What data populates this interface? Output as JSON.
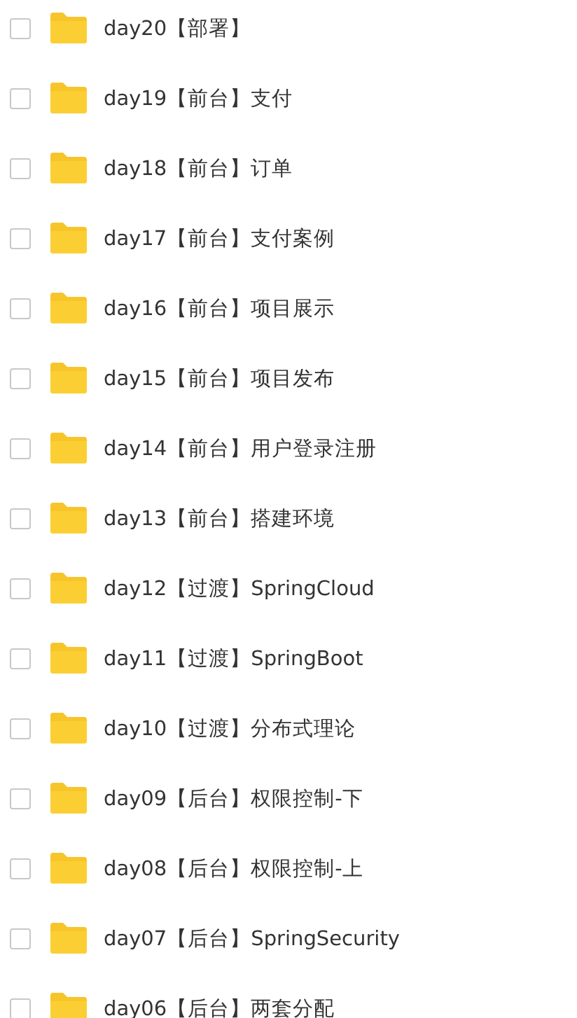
{
  "files": [
    {
      "name": "day20【部署】",
      "checked": false
    },
    {
      "name": "day19【前台】支付",
      "checked": false
    },
    {
      "name": "day18【前台】订单",
      "checked": false
    },
    {
      "name": "day17【前台】支付案例",
      "checked": false
    },
    {
      "name": "day16【前台】项目展示",
      "checked": false
    },
    {
      "name": "day15【前台】项目发布",
      "checked": false
    },
    {
      "name": "day14【前台】用户登录注册",
      "checked": false
    },
    {
      "name": "day13【前台】搭建环境",
      "checked": false
    },
    {
      "name": "day12【过渡】SpringCloud",
      "checked": false
    },
    {
      "name": "day11【过渡】SpringBoot",
      "checked": false
    },
    {
      "name": "day10【过渡】分布式理论",
      "checked": false
    },
    {
      "name": "day09【后台】权限控制-下",
      "checked": false
    },
    {
      "name": "day08【后台】权限控制-上",
      "checked": false
    },
    {
      "name": "day07【后台】SpringSecurity",
      "checked": false
    },
    {
      "name": "day06【后台】两套分配",
      "checked": false
    }
  ]
}
